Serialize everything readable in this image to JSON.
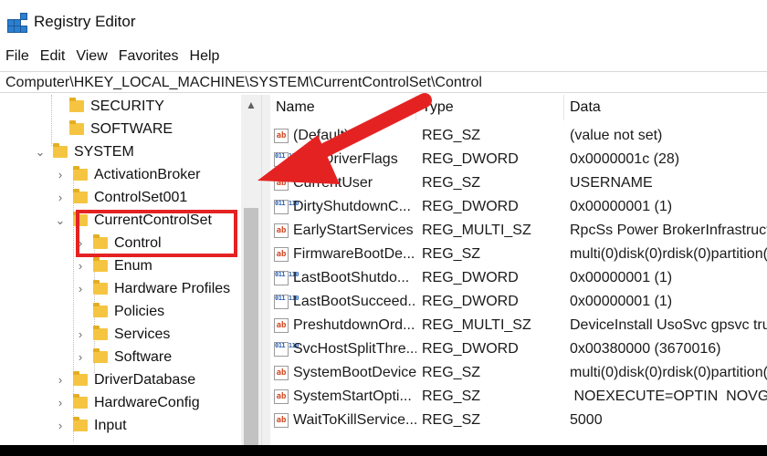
{
  "window": {
    "title": "Registry Editor",
    "icon": "registry-editor-icon"
  },
  "menu": [
    "File",
    "Edit",
    "View",
    "Favorites",
    "Help"
  ],
  "address": "Computer\\HKEY_LOCAL_MACHINE\\SYSTEM\\CurrentControlSet\\Control",
  "tree": [
    {
      "label": "SECURITY",
      "expanded": false,
      "chevron": ""
    },
    {
      "label": "SOFTWARE",
      "expanded": false,
      "chevron": ""
    },
    {
      "label": "SYSTEM",
      "expanded": true,
      "chevron": "⌄"
    },
    {
      "label": "ActivationBroker",
      "expanded": false,
      "chevron": "›"
    },
    {
      "label": "ControlSet001",
      "expanded": false,
      "chevron": "›"
    },
    {
      "label": "CurrentControlSet",
      "expanded": true,
      "chevron": "⌄"
    },
    {
      "label": "Control",
      "expanded": false,
      "chevron": "›",
      "selected": true
    },
    {
      "label": "Enum",
      "expanded": false,
      "chevron": "›"
    },
    {
      "label": "Hardware Profiles",
      "expanded": false,
      "chevron": "›"
    },
    {
      "label": "Policies",
      "expanded": false,
      "chevron": ""
    },
    {
      "label": "Services",
      "expanded": false,
      "chevron": "›"
    },
    {
      "label": "Software",
      "expanded": false,
      "chevron": "›"
    },
    {
      "label": "DriverDatabase",
      "expanded": false,
      "chevron": "›"
    },
    {
      "label": "HardwareConfig",
      "expanded": false,
      "chevron": "›"
    },
    {
      "label": "Input",
      "expanded": false,
      "chevron": "›"
    }
  ],
  "columns": {
    "name": "Name",
    "type": "Type",
    "data": "Data"
  },
  "values": [
    {
      "icon": "ab",
      "name": "(Default)",
      "type": "REG_SZ",
      "data": "(value not set)"
    },
    {
      "icon": "bin",
      "name": "BootDriverFlags",
      "type": "REG_DWORD",
      "data": "0x0000001c (28)"
    },
    {
      "icon": "ab",
      "name": "CurrentUser",
      "type": "REG_SZ",
      "data": "USERNAME"
    },
    {
      "icon": "bin",
      "name": "DirtyShutdownC...",
      "type": "REG_DWORD",
      "data": "0x00000001 (1)"
    },
    {
      "icon": "ab",
      "name": "EarlyStartServices",
      "type": "REG_MULTI_SZ",
      "data": "RpcSs Power BrokerInfrastructu"
    },
    {
      "icon": "ab",
      "name": "FirmwareBootDe...",
      "type": "REG_SZ",
      "data": "multi(0)disk(0)rdisk(0)partition("
    },
    {
      "icon": "bin",
      "name": "LastBootShutdo...",
      "type": "REG_DWORD",
      "data": "0x00000001 (1)"
    },
    {
      "icon": "bin",
      "name": "LastBootSucceed...",
      "type": "REG_DWORD",
      "data": "0x00000001 (1)"
    },
    {
      "icon": "ab",
      "name": "PreshutdownOrd...",
      "type": "REG_MULTI_SZ",
      "data": "DeviceInstall UsoSvc gpsvc tru"
    },
    {
      "icon": "bin",
      "name": "SvcHostSplitThre...",
      "type": "REG_DWORD",
      "data": "0x00380000 (3670016)"
    },
    {
      "icon": "ab",
      "name": "SystemBootDevice",
      "type": "REG_SZ",
      "data": "multi(0)disk(0)rdisk(0)partition("
    },
    {
      "icon": "ab",
      "name": "SystemStartOpti...",
      "type": "REG_SZ",
      "data": " NOEXECUTE=OPTIN  NOVGA"
    },
    {
      "icon": "ab",
      "name": "WaitToKillService...",
      "type": "REG_SZ",
      "data": "5000"
    }
  ],
  "colors": {
    "highlight": "#e52222",
    "arrow": "#e52222",
    "folder": "#f5c542"
  }
}
